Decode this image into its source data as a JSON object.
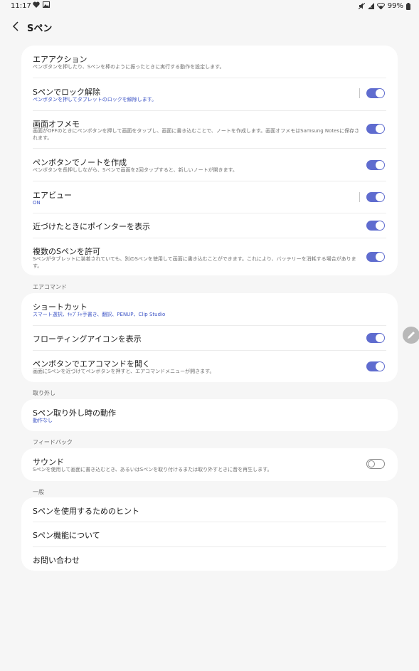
{
  "status": {
    "time": "11:17",
    "battery": "99%",
    "icons_left": [
      "heart-icon",
      "image-icon"
    ],
    "icons_right": [
      "no-sound-icon",
      "signal-icon",
      "wifi-icon",
      "battery-icon"
    ]
  },
  "header": {
    "title": "Sペン"
  },
  "main_card": {
    "items": [
      {
        "title": "エアアクション",
        "subtitle": "ペンボタンを押したり、Sペンを棒のように振ったときに実行する動作を設定します。"
      },
      {
        "title": "Sペンでロック解除",
        "subtitle": "ペンボタンを押してタブレットのロックを解除します。",
        "toggle": "on"
      },
      {
        "title": "画面オフメモ",
        "subtitle": "画面がOFFのときにペンボタンを押して画面をタップし、画面に書き込むことで、ノートを作成します。画面オフメモはSamsung Notesに保存されます。",
        "toggle": "on"
      },
      {
        "title": "ペンボタンでノートを作成",
        "subtitle": "ペンボタンを長押ししながら、Sペンで画面を2回タップすると、新しいノートが開きます。",
        "toggle": "on"
      },
      {
        "title": "エアビュー",
        "subtitle": "ON",
        "toggle": "on"
      },
      {
        "title": "近づけたときにポインターを表示",
        "toggle": "on"
      },
      {
        "title": "複数のSペンを許可",
        "subtitle": "Sペンがタブレットに装着されていても、別のSペンを使用して画面に書き込むことができます。これにより、バッテリーを消耗する場合があります。",
        "toggle": "on"
      }
    ]
  },
  "air_command": {
    "header": "エアコマンド",
    "items": [
      {
        "title": "ショートカット",
        "subtitle": "スマート選択、ｷｬﾌﾟﾁｬ手書き、翻訳、PENUP、Clip Studio"
      },
      {
        "title": "フローティングアイコンを表示",
        "toggle": "on"
      },
      {
        "title": "ペンボタンでエアコマンドを開く",
        "subtitle": "画面にSペンを近づけてペンボタンを押すと、エアコマンドメニューが開きます。",
        "toggle": "on"
      }
    ]
  },
  "detach": {
    "header": "取り外し",
    "items": [
      {
        "title": "Sペン取り外し時の動作",
        "subtitle": "動作なし"
      }
    ]
  },
  "feedback": {
    "header": "フィードバック",
    "items": [
      {
        "title": "サウンド",
        "subtitle": "Sペンを使用して画面に書き込むとき、あるいはSペンを取り付けるまたは取り外すときに音を再生します。",
        "toggle": "off"
      }
    ]
  },
  "general": {
    "header": "一般",
    "items": [
      {
        "title": "Sペンを使用するためのヒント"
      },
      {
        "title": "Sペン機能について"
      },
      {
        "title": "お問い合わせ"
      }
    ]
  },
  "colors": {
    "accent": "#5f6ccf",
    "link_text": "#3e55c6",
    "background": "#f6f6f6",
    "card": "#ffffff"
  }
}
